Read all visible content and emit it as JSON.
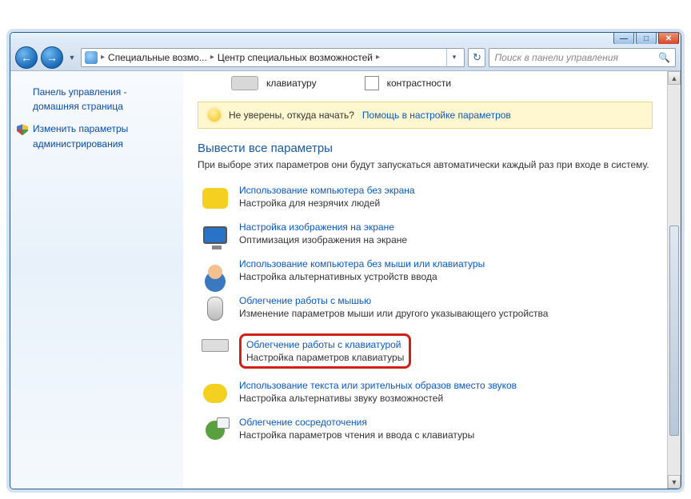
{
  "winbuttons": {
    "min": "—",
    "max": "□",
    "close": "✕"
  },
  "nav": {
    "back": "←",
    "fwd": "→",
    "chev": "▼",
    "refresh": "↻"
  },
  "address": {
    "seg1": "Специальные возмо...",
    "seg2": "Центр специальных возможностей",
    "sep": "▸",
    "dd": "▾"
  },
  "search": {
    "placeholder": "Поиск в панели управления",
    "icon": "🔍"
  },
  "sidebar": {
    "home1": "Панель управления -",
    "home2": "домашняя страница",
    "admin1": "Изменить параметры",
    "admin2": "администрирования"
  },
  "top": {
    "kbd": "клавиатуру",
    "contrast": "контрастности"
  },
  "hint": {
    "q": "Не уверены, откуда начать?",
    "link": "Помощь в настройке параметров"
  },
  "section": {
    "title": "Вывести все параметры",
    "desc": "При выборе этих параметров они будут запускаться автоматически каждый раз при входе в систему."
  },
  "items": [
    {
      "title": "Использование компьютера без экрана",
      "desc": "Настройка для незрячих людей"
    },
    {
      "title": "Настройка изображения на экране",
      "desc": "Оптимизация изображения на экране"
    },
    {
      "title": "Использование компьютера без мыши или клавиатуры",
      "desc": "Настройка альтернативных устройств ввода"
    },
    {
      "title": "Облегчение работы с мышью",
      "desc": "Изменение параметров мыши или другого указывающего устройства"
    },
    {
      "title": "Облегчение работы с клавиатурой",
      "desc": "Настройка параметров клавиатуры"
    },
    {
      "title": "Использование текста или зрительных образов вместо звуков",
      "desc": "Настройка альтернативы звуку возможностей"
    },
    {
      "title": "Облегчение сосредоточения",
      "desc": "Настройка параметров чтения и ввода с клавиатуры"
    }
  ],
  "scroll": {
    "up": "▲",
    "down": "▼"
  }
}
